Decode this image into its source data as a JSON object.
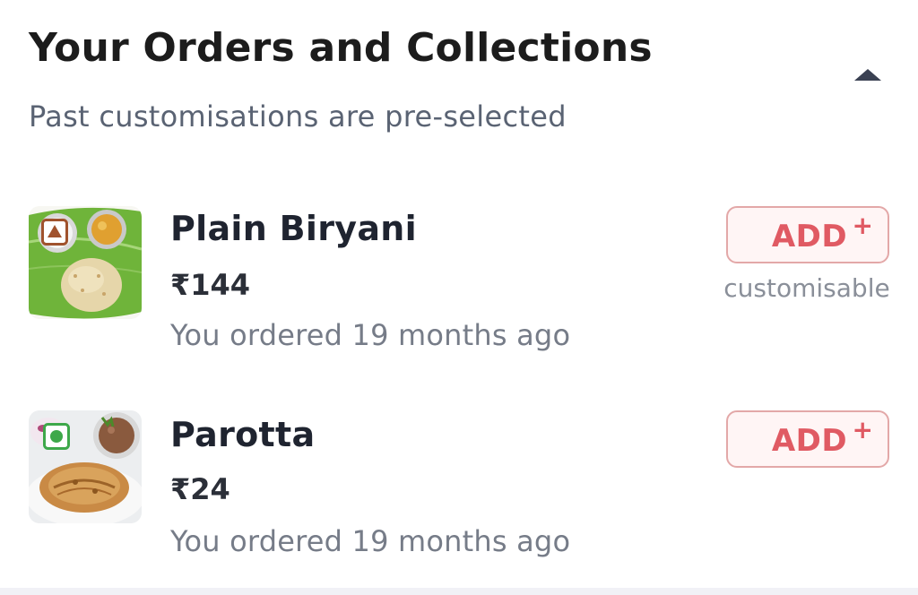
{
  "section": {
    "title": "Your Orders and Collections",
    "subtitle": "Past customisations are pre-selected",
    "collapse_icon": "chevron-up-icon"
  },
  "items": [
    {
      "name": "Plain Biryani",
      "price": "₹144",
      "ordered": "You ordered 19 months ago",
      "add_label": "ADD",
      "add_plus": "+",
      "note": "customisable",
      "diet_marker": "non-veg",
      "marker_color": "#a0522d"
    },
    {
      "name": "Parotta",
      "price": "₹24",
      "ordered": "You ordered 19 months ago",
      "add_label": "ADD",
      "add_plus": "+",
      "note": "",
      "diet_marker": "veg",
      "marker_color": "#3ea84a"
    }
  ],
  "colors": {
    "accent": "#e05a63",
    "add_border": "#e3a8a8",
    "add_bg": "#fff5f5"
  }
}
